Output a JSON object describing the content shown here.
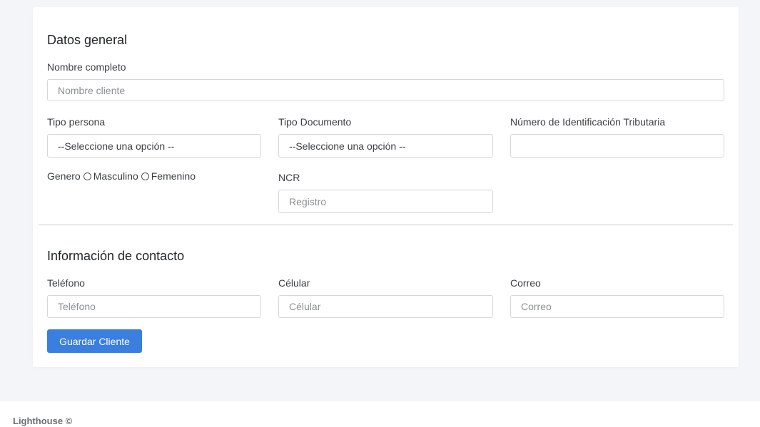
{
  "general": {
    "title": "Datos general",
    "nombre_label": "Nombre completo",
    "nombre_placeholder": "Nombre cliente",
    "tipo_persona_label": "Tipo persona",
    "tipo_persona_value": "--Seleccione una opción --",
    "tipo_documento_label": "Tipo Documento",
    "tipo_documento_value": "--Seleccione una opción --",
    "nit_label": "Número de Identificación Tributaria",
    "nit_placeholder": "",
    "genero_label": "Genero",
    "genero_options": [
      "Masculino",
      "Femenino"
    ],
    "ncr_label": "NCR",
    "ncr_placeholder": "Registro"
  },
  "contact": {
    "title": "Información de contacto",
    "telefono_label": "Teléfono",
    "telefono_placeholder": "Teléfono",
    "celular_label": "Célular",
    "celular_placeholder": "Célular",
    "correo_label": "Correo",
    "correo_placeholder": "Correo"
  },
  "actions": {
    "save_label": "Guardar Cliente"
  },
  "footer": {
    "text": "Lighthouse ©"
  },
  "colors": {
    "primary": "#3a7ee0",
    "background": "#f4f5f9"
  }
}
